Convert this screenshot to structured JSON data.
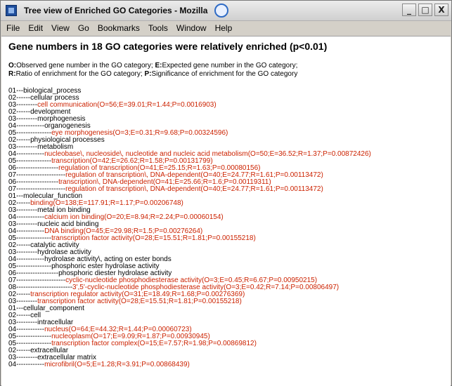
{
  "window": {
    "title": "Tree view of Enriched GO Categories - Mozilla",
    "controls": [
      "_",
      "□",
      "X"
    ]
  },
  "menu": [
    "File",
    "Edit",
    "View",
    "Go",
    "Bookmarks",
    "Tools",
    "Window",
    "Help"
  ],
  "page": {
    "heading": "Gene numbers in 18 GO categories were relatively enriched (p<0.01)",
    "legend_line1": {
      "k1": "O:",
      "v1": "Observed gene number in the GO category; ",
      "k2": "E:",
      "v2": "Expected gene number in the GO category;"
    },
    "legend_line2": {
      "k1": "R:",
      "v1": "Ratio of enrichment for the GO category; ",
      "k2": "P:",
      "v2": "Significance of enrichment for the GO category"
    }
  },
  "tree": [
    {
      "prefix": "01---",
      "text": "biological_process",
      "color": "black"
    },
    {
      "prefix": "02------",
      "text": "cellular process",
      "color": "black"
    },
    {
      "prefix": "03---------",
      "text": "cell communication(O=56;E=39.01;R=1.44;P=0.0016903)",
      "color": "red"
    },
    {
      "prefix": "02------",
      "text": "development",
      "color": "black"
    },
    {
      "prefix": "03---------",
      "text": "morphogenesis",
      "color": "black"
    },
    {
      "prefix": "04------------",
      "text": "organogenesis",
      "color": "black"
    },
    {
      "prefix": "05---------------",
      "text": "eye morphogenesis(O=3;E=0.31;R=9.68;P=0.00324596)",
      "color": "red"
    },
    {
      "prefix": "02------",
      "text": "physiological processes",
      "color": "black"
    },
    {
      "prefix": "03---------",
      "text": "metabolism",
      "color": "black"
    },
    {
      "prefix": "04------------",
      "text": "nucleobase\\, nucleoside\\, nucleotide and nucleic acid metabolism(O=50;E=36.52;R=1.37;P=0.00872426)",
      "color": "red"
    },
    {
      "prefix": "05---------------",
      "text": "transcription(O=42;E=26.62;R=1.58;P=0.00131799)",
      "color": "red"
    },
    {
      "prefix": "06------------------",
      "text": "regulation of transcription(O=41;E=25.15;R=1.63;P=0.00080156)",
      "color": "red"
    },
    {
      "prefix": "07---------------------",
      "text": "regulation of transcription\\, DNA-dependent(O=40;E=24.77;R=1.61;P=0.00113472)",
      "color": "red"
    },
    {
      "prefix": "06------------------",
      "text": "transcription\\, DNA-dependent(O=41;E=25.66;R=1.6;P=0.00119311)",
      "color": "red"
    },
    {
      "prefix": "07---------------------",
      "text": "regulation of transcription\\, DNA-dependent(O=40;E=24.77;R=1.61;P=0.00113472)",
      "color": "red"
    },
    {
      "prefix": "01---",
      "text": "molecular_function",
      "color": "black"
    },
    {
      "prefix": "02------",
      "text": "binding(O=138;E=117.91;R=1.17;P=0.00206748)",
      "color": "red"
    },
    {
      "prefix": "03---------",
      "text": "metal ion binding",
      "color": "black"
    },
    {
      "prefix": "04------------",
      "text": "calcium ion binding(O=20;E=8.94;R=2.24;P=0.00060154)",
      "color": "red"
    },
    {
      "prefix": "03---------",
      "text": "nucleic acid binding",
      "color": "black"
    },
    {
      "prefix": "04------------",
      "text": "DNA binding(O=45;E=29.98;R=1.5;P=0.00276264)",
      "color": "red"
    },
    {
      "prefix": "05---------------",
      "text": "transcription factor activity(O=28;E=15.51;R=1.81;P=0.00155218)",
      "color": "red"
    },
    {
      "prefix": "02------",
      "text": "catalytic activity",
      "color": "black"
    },
    {
      "prefix": "03---------",
      "text": "hydrolase activity",
      "color": "black"
    },
    {
      "prefix": "04------------",
      "text": "hydrolase activity\\, acting on ester bonds",
      "color": "black"
    },
    {
      "prefix": "05---------------",
      "text": "phosphoric ester hydrolase activity",
      "color": "black"
    },
    {
      "prefix": "06------------------",
      "text": "phosphoric diester hydrolase activity",
      "color": "black"
    },
    {
      "prefix": "07---------------------",
      "text": "cyclic-nucleotide phosphodiesterase activity(O=3;E=0.45;R=6.67;P=0.00950215)",
      "color": "red"
    },
    {
      "prefix": "08------------------------",
      "text": "3',5'-cyclic-nucleotide phosphodiesterase activity(O=3;E=0.42;R=7.14;P=0.00806497)",
      "color": "red"
    },
    {
      "prefix": "02------",
      "text": "transcription regulator activity(O=31;E=18.49;R=1.68;P=0.00276369)",
      "color": "red"
    },
    {
      "prefix": "03---------",
      "text": "transcription factor activity(O=28;E=15.51;R=1.81;P=0.00155218)",
      "color": "red"
    },
    {
      "prefix": "01---",
      "text": "cellular_component",
      "color": "black"
    },
    {
      "prefix": "02------",
      "text": "cell",
      "color": "black"
    },
    {
      "prefix": "03---------",
      "text": "intracellular",
      "color": "black"
    },
    {
      "prefix": "04------------",
      "text": "nucleus(O=64;E=44.32;R=1.44;P=0.00060723)",
      "color": "red"
    },
    {
      "prefix": "05---------------",
      "text": "nucleoplasm(O=17;E=9.09;R=1.87;P=0.00930945)",
      "color": "red"
    },
    {
      "prefix": "05---------------",
      "text": "transcription factor complex(O=15;E=7.57;R=1.98;P=0.00869812)",
      "color": "red"
    },
    {
      "prefix": "02------",
      "text": "extracellular",
      "color": "black"
    },
    {
      "prefix": "03---------",
      "text": "extracellular matrix",
      "color": "black"
    },
    {
      "prefix": "04------------",
      "text": "microfibril(O=5;E=1.28;R=3.91;P=0.00868439)",
      "color": "red"
    }
  ]
}
